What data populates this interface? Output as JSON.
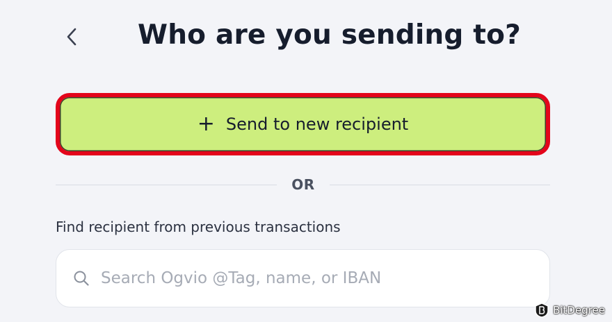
{
  "header": {
    "back_icon": "chevron-left-icon",
    "title": "Who are you sending to?"
  },
  "new_recipient_button": {
    "icon": "plus-icon",
    "icon_glyph": "+",
    "label": "Send to new recipient",
    "background_color": "#cdee7e",
    "highlight_color": "#e3051b"
  },
  "divider": {
    "label": "OR"
  },
  "search": {
    "section_label": "Find recipient from previous transactions",
    "icon": "search-icon",
    "placeholder": "Search Ogvio @Tag, name, or IBAN",
    "value": ""
  },
  "watermark": {
    "text": "BitDegree"
  }
}
